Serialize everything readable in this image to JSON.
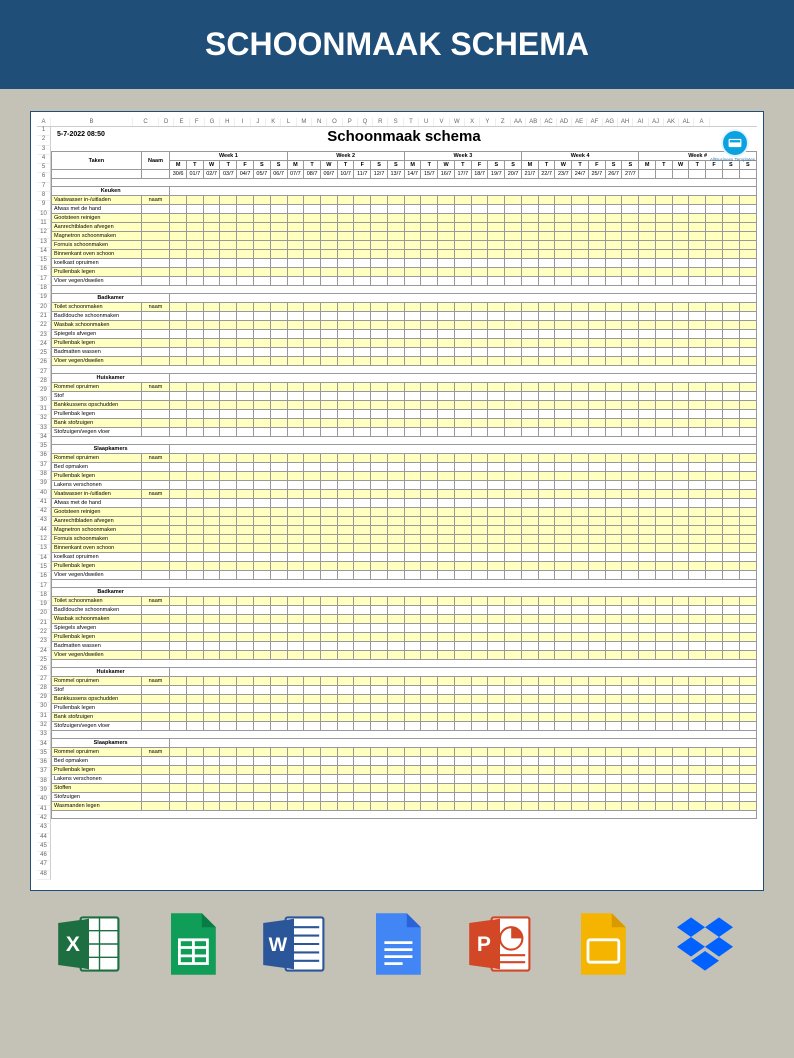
{
  "banner_title": "SCHOONMAAK SCHEMA",
  "datetime": "5-7-2022 08:50",
  "sheet_title": "Schoonmaak schema",
  "logo_label": "AllBusiness Templates",
  "excel_cols": [
    "A",
    "B",
    "C",
    "D",
    "E",
    "F",
    "G",
    "H",
    "I",
    "J",
    "K",
    "L",
    "M",
    "N",
    "O",
    "P",
    "Q",
    "R",
    "S",
    "T",
    "U",
    "V",
    "W",
    "X",
    "Y",
    "Z",
    "AA",
    "AB",
    "AC",
    "AD",
    "AE",
    "AF",
    "AG",
    "AH",
    "AI",
    "AJ",
    "AK",
    "AL",
    "A"
  ],
  "row_numbers_a": [
    "1",
    "2",
    "3",
    "4",
    "5",
    "6",
    "7",
    "8",
    "9",
    "10",
    "11",
    "12",
    "13",
    "14",
    "15",
    "16",
    "17",
    "18",
    "19",
    "20",
    "21",
    "22",
    "23",
    "24",
    "25",
    "26",
    "27",
    "28",
    "29",
    "30",
    "31",
    "32",
    "33",
    "34",
    "35",
    "36",
    "37",
    "38",
    "39",
    "40",
    "41",
    "42",
    "43",
    "44"
  ],
  "row_numbers_b": [
    "12",
    "13",
    "14",
    "15",
    "16",
    "17",
    "18",
    "19",
    "20",
    "21",
    "22",
    "23",
    "24",
    "25",
    "26",
    "27",
    "28",
    "29",
    "30",
    "31",
    "32",
    "33",
    "34",
    "35",
    "36",
    "37",
    "38",
    "39",
    "40",
    "41",
    "42",
    "43",
    "44",
    "45",
    "46",
    "47",
    "48"
  ],
  "header": {
    "taken": "Taken",
    "naam": "Naam",
    "weeks": [
      "Week 1",
      "Week 2",
      "Week 3",
      "Week 4",
      "Week #"
    ],
    "days": [
      "M",
      "T",
      "W",
      "T",
      "F",
      "S",
      "S"
    ]
  },
  "dates": [
    "30/6",
    "01/7",
    "02/7",
    "03/7",
    "04/7",
    "05/7",
    "06/7",
    "07/7",
    "08/7",
    "09/7",
    "10/7",
    "11/7",
    "12/7",
    "13/7",
    "14/7",
    "15/7",
    "16/7",
    "17/7",
    "18/7",
    "19/7",
    "20/7",
    "21/7",
    "22/7",
    "23/7",
    "24/7",
    "25/7",
    "26/7",
    "27/7"
  ],
  "naam_label": "naam",
  "sections": [
    {
      "title": "Keuken",
      "tasks": [
        {
          "t": "Vaatwasser in-/uitladen",
          "hl": true,
          "naam": true
        },
        {
          "t": "Afwas met de hand",
          "hl": false
        },
        {
          "t": "Gootsteen reinigen",
          "hl": true
        },
        {
          "t": "Aanrechtbladen afvegen",
          "hl": true
        },
        {
          "t": "Magnetron schoonmaken",
          "hl": true
        },
        {
          "t": "Fornuis schoonmaken",
          "hl": true
        },
        {
          "t": "Binnenkant oven schoon",
          "hl": true
        },
        {
          "t": "koelkast opruimen",
          "hl": false
        },
        {
          "t": "Prullenbak legen",
          "hl": true
        },
        {
          "t": "Vloer vegen/dweilen",
          "hl": false
        }
      ]
    },
    {
      "title": "Badkamer",
      "tasks": [
        {
          "t": "Toilet schoonmaken",
          "hl": true,
          "naam": true
        },
        {
          "t": "Bad/douche schoonmaken",
          "hl": false
        },
        {
          "t": "Wasbak schoonmaken",
          "hl": true
        },
        {
          "t": "Spiegels afvegen",
          "hl": false
        },
        {
          "t": "Prullenbak legen",
          "hl": true
        },
        {
          "t": "Badmatten wassen",
          "hl": false
        },
        {
          "t": "Vloer vegen/dweilen",
          "hl": true
        }
      ]
    },
    {
      "title": "Huiskamer",
      "tasks": [
        {
          "t": "Rommel opruimen",
          "hl": true,
          "naam": true
        },
        {
          "t": "Stof",
          "hl": false
        },
        {
          "t": "Bankkussens opschudden",
          "hl": true
        },
        {
          "t": "Prullenbak legen",
          "hl": false
        },
        {
          "t": "Bank stofzuigen",
          "hl": true
        },
        {
          "t": "Stofzuigen/vegen vloer",
          "hl": false
        }
      ]
    },
    {
      "title": "Slaapkamers",
      "tasks": [
        {
          "t": "Rommel opruimen",
          "hl": true,
          "naam": true
        },
        {
          "t": "Bed opmaken",
          "hl": false
        },
        {
          "t": "Prullenbak legen",
          "hl": true
        },
        {
          "t": "Lakens verschonen",
          "hl": false
        },
        {
          "t": "Vaatwasser in-/uitladen",
          "hl": true,
          "naam": true
        },
        {
          "t": "Afwas met de hand",
          "hl": false
        },
        {
          "t": "Gootsteen reinigen",
          "hl": true
        },
        {
          "t": "Aanrechtbladen afvegen",
          "hl": true
        },
        {
          "t": "Magnetron schoonmaken",
          "hl": true
        },
        {
          "t": "Fornuis schoonmaken",
          "hl": true
        },
        {
          "t": "Binnenkant oven schoon",
          "hl": true
        },
        {
          "t": "koelkast opruimen",
          "hl": false
        },
        {
          "t": "Prullenbak legen",
          "hl": true
        },
        {
          "t": "Vloer vegen/dweilen",
          "hl": false
        }
      ]
    },
    {
      "title": "Badkamer",
      "tasks": [
        {
          "t": "Toilet schoonmaken",
          "hl": true,
          "naam": true
        },
        {
          "t": "Bad/douche schoonmaken",
          "hl": false
        },
        {
          "t": "Wasbak schoonmaken",
          "hl": true
        },
        {
          "t": "Spiegels afvegen",
          "hl": false
        },
        {
          "t": "Prullenbak legen",
          "hl": true
        },
        {
          "t": "Badmatten wassen",
          "hl": false
        },
        {
          "t": "Vloer vegen/dweilen",
          "hl": true
        }
      ]
    },
    {
      "title": "Huiskamer",
      "tasks": [
        {
          "t": "Rommel opruimen",
          "hl": true,
          "naam": true
        },
        {
          "t": "Stof",
          "hl": false
        },
        {
          "t": "Bankkussens opschudden",
          "hl": true
        },
        {
          "t": "Prullenbak legen",
          "hl": false
        },
        {
          "t": "Bank stofzuigen",
          "hl": true
        },
        {
          "t": "Stofzuigen/vegen vloer",
          "hl": false
        }
      ]
    },
    {
      "title": "Slaapkamers",
      "tasks": [
        {
          "t": "Rommel opruimen",
          "hl": true,
          "naam": true
        },
        {
          "t": "Bed opmaken",
          "hl": false
        },
        {
          "t": "Prullenbak legen",
          "hl": true
        },
        {
          "t": "Lakens verschonen",
          "hl": false
        },
        {
          "t": "Stoffen",
          "hl": true
        },
        {
          "t": "Stofzuigen",
          "hl": false
        },
        {
          "t": "Wasmanden legen",
          "hl": true
        }
      ]
    }
  ]
}
